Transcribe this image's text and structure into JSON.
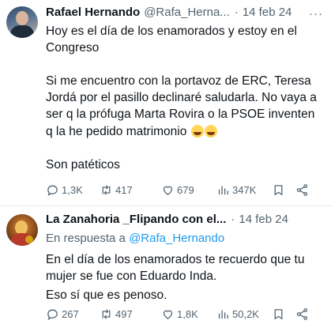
{
  "tweets": [
    {
      "author_name": "Rafael Hernando",
      "handle": "@Rafa_Herna...",
      "date": "14 feb 24",
      "more": "···",
      "paragraphs": [
        "Hoy es el día de los enamorados y estoy en el Congreso",
        "Si me encuentro con la portavoz de ERC, Teresa Jordá por el pasillo declinaré saludarla. No vaya a ser q la prófuga Marta Rovira o la PSOE inventen q la he pedido matrimonio",
        "Son patéticos"
      ],
      "actions": {
        "replies": "1,3K",
        "reposts": "417",
        "likes": "679",
        "views": "347K"
      }
    },
    {
      "author_name": "La Zanahoria _Flipando con el...",
      "date": "14 feb 24",
      "reply_prefix": "En respuesta a",
      "reply_mention": "@Rafa_Hernando",
      "paragraphs": [
        "En el día de los enamorados te recuerdo que tu mujer se fue con Eduardo Inda.",
        "Eso sí que es penoso."
      ],
      "actions": {
        "replies": "267",
        "reposts": "497",
        "likes": "1,8K",
        "views": "50,2K"
      }
    }
  ]
}
